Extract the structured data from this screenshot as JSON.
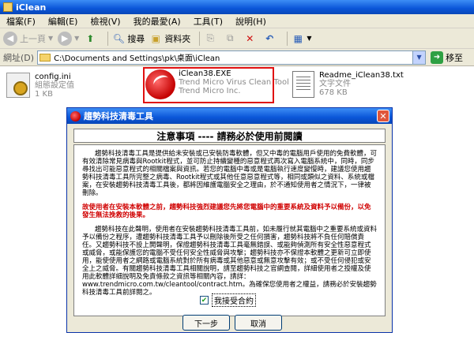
{
  "window": {
    "title": "iClean"
  },
  "menu": [
    "檔案(F)",
    "編輯(E)",
    "檢視(V)",
    "我的最愛(A)",
    "工具(T)",
    "說明(H)"
  ],
  "toolbar": {
    "back": "上一頁",
    "search": "搜尋",
    "folders": "資料夾"
  },
  "address": {
    "label": "網址(D)",
    "path": "C:\\Documents and Settings\\pk\\桌面\\iClean",
    "go": "移至"
  },
  "files": [
    {
      "name": "config.ini",
      "type": "組態設定值",
      "size": "1 KB",
      "icon": "config-file-icon"
    },
    {
      "name": "iClean38.EXE",
      "type": "Trend Micro Virus Clean Tool",
      "size": "Trend Micro Inc.",
      "icon": "iclean-exe-icon"
    },
    {
      "name": "Readme_iClean38.txt",
      "type": "文字文件",
      "size": "678 KB",
      "icon": "text-file-icon"
    }
  ],
  "dialog": {
    "title": "趨勢科技清毒工具",
    "heading": "注意事項 ---- 請務必於使用前閱讀",
    "para1": "趨勢科技清毒工具是提供給未安裝或已安裝防毒軟體，但又中毒的電腦用戶使用的免費軟體，可有效清除常見病毒與Rootkit程式，並可防止持續變種的惡意程式再次寫入電腦系統中，同時，同步尋找出可能惡意程式的相關檔案與資訊。若您的電腦中毒或是電腦執行速度變慢時，建議您使用趨勢科技清毒工具所完整之病毒、Rootkit程式或其他任意惡意程式等，相同或類似之資料、系統或檔案，在安裝趨勢科技清毒工具後，都將因維護電腦安全之理由，於不通知使用者之情況下，一律被刪除。",
    "para2": "故使用者在安裝本軟體之前，趨勢科技強烈建議您先將您電腦中的重要系統及資料予以備份，以免發生無法挽救的後果。",
    "para3": "趨勢科技在此聲明，使用者在安裝趨勢科技清毒工具前，如未履行就其電腦中之重要系統或資料予以備份之程序，遭趨勢科技清毒工具予以刪除後所受之任何損害，趨勢科技將不負任何賠償責任。又趨勢科技不設上開聲明，保證趨勢科技清毒工具毫無錯誤、或能夠偵測所有安全性惡意程式或威脅，或能保護您的電腦不受任何安全性威脅與攻擊；趨勢科技亦不保證本軟體之更新可立即使用，能使使用者之網路或電腦系統對於所有病毒或其他惡意或無意攻擊有效；或不受任何侵犯或安全上之威脅。有關趨勢科技清毒工具相關說明，請至趨勢科技之官網查閱，詳細使用者之授權及使用此軟體詳細說明及免責條款之資訊等相關內容，請詳：www.trendmicro.com.tw/cleantool/contract.htm。為確保您使用者之權益，請務必於安裝趨勢科技清毒工具前詳閱之。",
    "agree_label": "我接受合約",
    "next": "下一步",
    "cancel": "取消"
  }
}
